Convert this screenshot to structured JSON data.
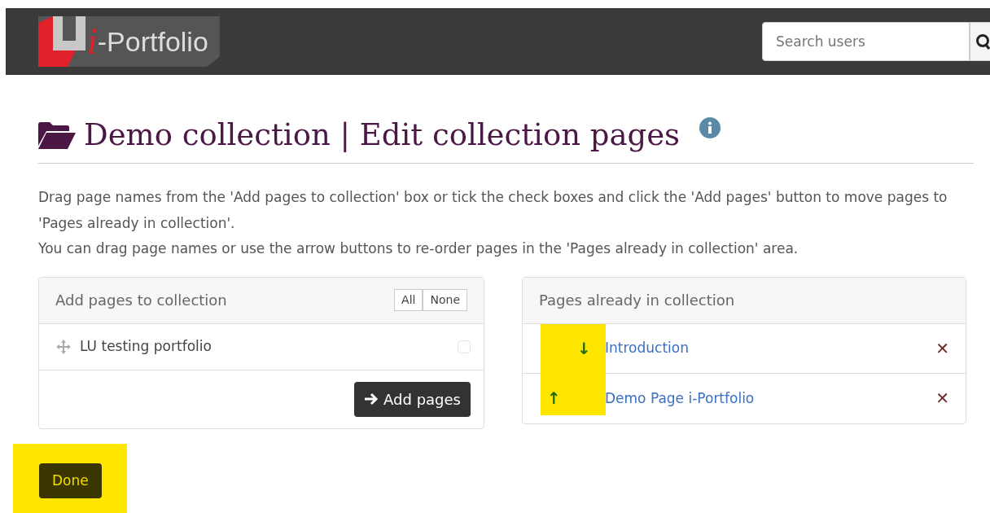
{
  "header": {
    "logo_text": "-Portfolio",
    "logo_letter": "i",
    "search": {
      "placeholder": "Search users"
    }
  },
  "page_title": "Demo collection | Edit collection pages",
  "instructions": [
    "Drag page names from the 'Add pages to collection' box or tick the check boxes and click the 'Add pages' button to move pages to 'Pages already in collection'.",
    "You can drag page names or use the arrow buttons to re-order pages in the 'Pages already in collection' area."
  ],
  "add_panel": {
    "title": "Add pages to collection",
    "select_buttons": [
      "All",
      "None"
    ],
    "pages": [
      {
        "name": "LU testing portfolio",
        "checked": false
      }
    ],
    "add_button": "Add pages"
  },
  "collection_panel": {
    "title": "Pages already in collection",
    "pages": [
      {
        "name": "Introduction",
        "move_up": false,
        "move_down": true,
        "highlighted": true,
        "remove": "✕"
      },
      {
        "name": "Demo Page i-Portfolio",
        "move_up": true,
        "move_down": false,
        "highlighted": true,
        "remove": "✕"
      }
    ],
    "arrow_up": "↑",
    "arrow_down": "↓"
  },
  "done_button": {
    "label": "Done",
    "highlighted": true
  }
}
